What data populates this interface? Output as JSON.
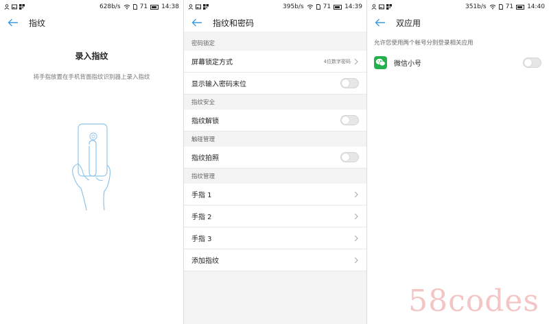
{
  "colors": {
    "accent": "#3a9bdc",
    "wechat": "#22b14c",
    "watermark": "#eb9696"
  },
  "screen1": {
    "status": {
      "speed": "628b/s",
      "battery": "71",
      "time": "14:38"
    },
    "title": "指纹",
    "enroll_title": "录入指纹",
    "enroll_hint": "将手指放置在手机背面指纹识别器上录入指纹"
  },
  "screen2": {
    "status": {
      "speed": "395b/s",
      "battery": "71",
      "time": "14:39"
    },
    "title": "指纹和密码",
    "sections": {
      "lock_header": "密码锁定",
      "screen_lock_label": "屏幕锁定方式",
      "screen_lock_value": "4位数字密码",
      "show_last_digit_label": "显示输入密码末位",
      "security_header": "指纹安全",
      "unlock_label": "指纹解锁",
      "touch_header": "触碰管理",
      "photo_label": "指纹拍照",
      "manage_header": "指纹管理",
      "fingers": [
        "手指 1",
        "手指 2",
        "手指 3"
      ],
      "add_label": "添加指纹"
    }
  },
  "screen3": {
    "status": {
      "speed": "351b/s",
      "battery": "71",
      "time": "14:40"
    },
    "title": "双应用",
    "desc": "允许您使用两个帐号分别登录相关应用",
    "app_label": "微信小号"
  },
  "icons": [
    "back-arrow-icon",
    "wifi-icon",
    "battery-icon",
    "sim-icon",
    "chevron-right-icon",
    "wechat-icon",
    "fingerprint-hand-icon"
  ],
  "watermark": "58codes"
}
